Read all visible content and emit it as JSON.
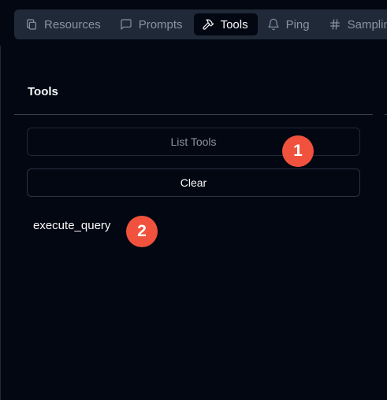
{
  "tabs": [
    {
      "label": "Resources",
      "icon": "copy-icon",
      "active": false
    },
    {
      "label": "Prompts",
      "icon": "message-square-icon",
      "active": false
    },
    {
      "label": "Tools",
      "icon": "hammer-icon",
      "active": true
    },
    {
      "label": "Ping",
      "icon": "bell-icon",
      "active": false
    },
    {
      "label": "Samplin",
      "icon": "hash-icon",
      "active": false
    }
  ],
  "panel": {
    "title": "Tools",
    "list_button": "List Tools",
    "clear_button": "Clear",
    "tools": [
      "execute_query"
    ]
  },
  "annotations": {
    "badge_1": "1",
    "badge_2": "2"
  },
  "colors": {
    "background": "#030712",
    "tabbar": "#1f2937",
    "badge": "#f0523d",
    "text_muted": "#8b93a1",
    "text": "#f9fafb"
  }
}
